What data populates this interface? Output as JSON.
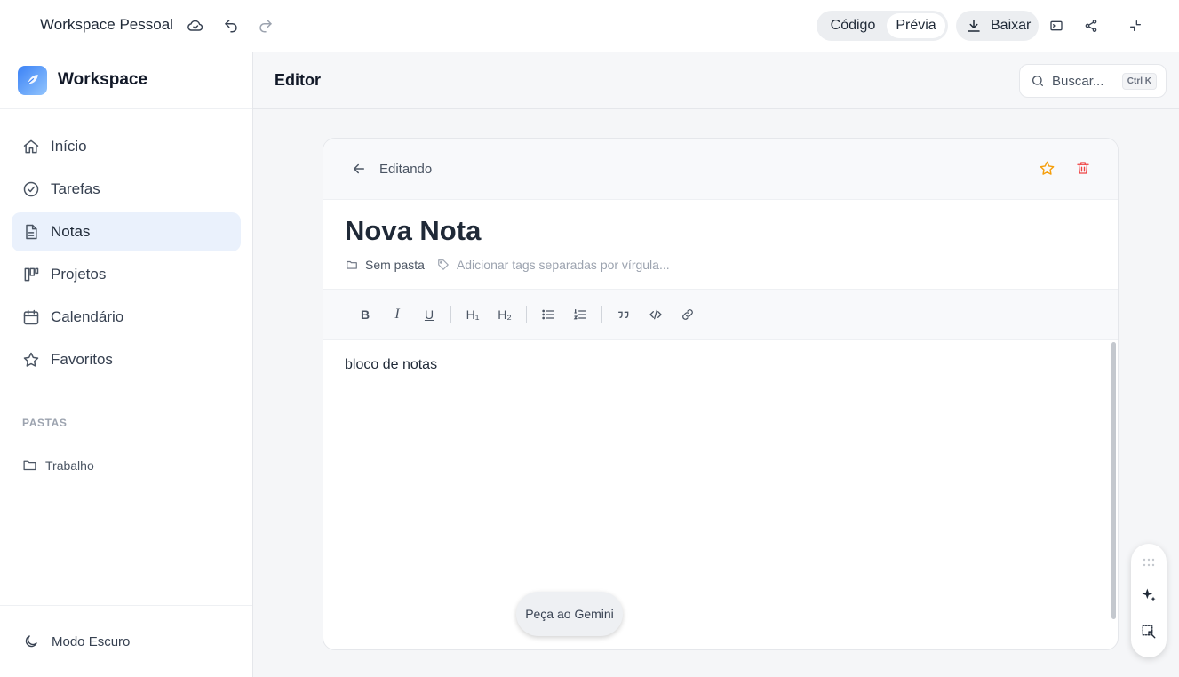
{
  "topbar": {
    "workspace_title": "Workspace Pessoal",
    "view_code": "Código",
    "view_preview": "Prévia",
    "download_label": "Baixar"
  },
  "sidebar": {
    "brand": "Workspace",
    "items": [
      {
        "label": "Início",
        "icon": "home-icon",
        "active": false
      },
      {
        "label": "Tarefas",
        "icon": "check-circle-icon",
        "active": false
      },
      {
        "label": "Notas",
        "icon": "document-icon",
        "active": true
      },
      {
        "label": "Projetos",
        "icon": "kanban-icon",
        "active": false
      },
      {
        "label": "Calendário",
        "icon": "calendar-icon",
        "active": false
      },
      {
        "label": "Favoritos",
        "icon": "star-icon",
        "active": false
      }
    ],
    "folders_section": "PASTAS",
    "folders": [
      "Trabalho"
    ],
    "dark_mode_label": "Modo Escuro"
  },
  "main": {
    "title": "Editor",
    "search_placeholder": "Buscar...",
    "search_shortcut": "Ctrl K"
  },
  "note": {
    "mode": "Editando",
    "title": "Nova Nota",
    "folder": "Sem pasta",
    "tags_placeholder": "Adicionar tags separadas por vírgula...",
    "content": "bloco de notas"
  },
  "toolbar": {
    "bold": "B",
    "italic": "I",
    "underline": "U",
    "h1": "H₁",
    "h2": "H₂"
  },
  "gemini": {
    "label": "Peça ao Gemini"
  },
  "colors": {
    "accent": "#3b82f6",
    "star": "#f59e0b",
    "delete": "#ef4444",
    "active_nav": "#eaf1fc"
  }
}
